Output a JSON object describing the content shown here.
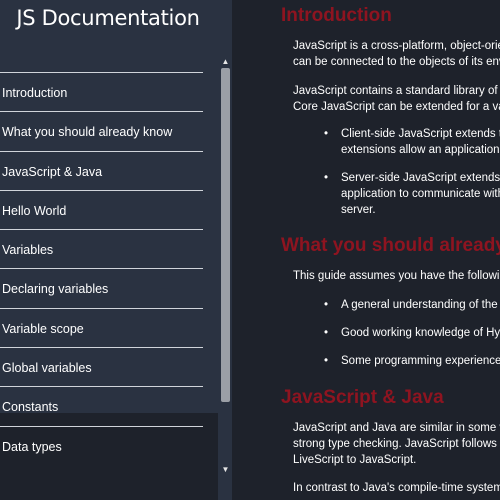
{
  "sidebar": {
    "title": "JS Documentation",
    "items": [
      {
        "label": "Introduction"
      },
      {
        "label": "What you should already know"
      },
      {
        "label": "JavaScript & Java"
      },
      {
        "label": "Hello World"
      },
      {
        "label": "Variables"
      },
      {
        "label": "Declaring variables"
      },
      {
        "label": "Variable scope"
      },
      {
        "label": "Global variables"
      },
      {
        "label": "Constants"
      },
      {
        "label": "Data types"
      }
    ],
    "scroll_up_icon": "▲",
    "scroll_down_icon": "▼"
  },
  "main": {
    "sections": [
      {
        "title": "Introduction",
        "paragraphs": [
          [
            "JavaScript is a cross-platform, object-oriente",
            "can be connected to the objects of its enviro"
          ],
          [
            "JavaScript contains a standard library of obje",
            "Core JavaScript can be extended for a variety"
          ]
        ],
        "bullets": [
          [
            "Client-side JavaScript extends the co",
            "extensions allow an application to p"
          ],
          [
            "Server-side JavaScript extends the c",
            "application to communicate with a d",
            "server."
          ]
        ]
      },
      {
        "title": "What you should already know",
        "paragraphs": [
          [
            "This guide assumes you have the following basic"
          ]
        ],
        "bullets": [
          [
            "A general understanding of the Inter"
          ],
          [
            "Good working knowledge of HyperT"
          ],
          [
            "Some programming experience. If y"
          ]
        ]
      },
      {
        "title": "JavaScript & Java",
        "paragraphs": [
          [
            "JavaScript and Java are similar in some ways b",
            "strong type checking. JavaScript follows most",
            "LiveScript to JavaScript."
          ],
          [
            "In contrast to Java's compile-time system of cl"
          ]
        ]
      }
    ]
  },
  "colors": {
    "sidebar_bg": "#2a3241",
    "page_bg": "#1e222b",
    "heading": "#8e1420",
    "text": "#ffffff"
  }
}
